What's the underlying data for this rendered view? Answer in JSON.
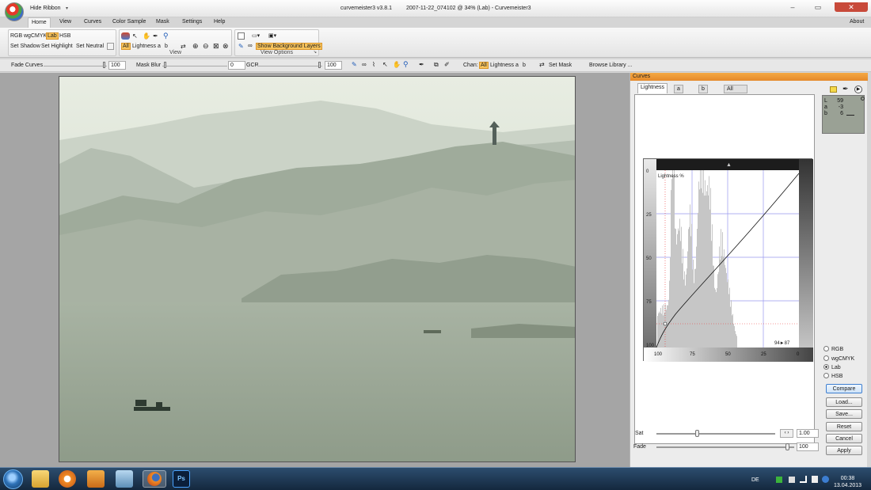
{
  "window": {
    "hide_ribbon": "Hide Ribbon",
    "app_title": "curvemeister3 v3.8.1",
    "doc_title": "2007-11-22_074102 @ 34% (Lab) - Curvemeister3"
  },
  "tabs": [
    "Home",
    "View",
    "Curves",
    "Color Sample",
    "Mask",
    "Settings",
    "Help"
  ],
  "about": "About",
  "ribbon": {
    "modes": [
      "RGB",
      "wgCMYK",
      "Lab",
      "HSB"
    ],
    "active_mode": "Lab",
    "set_shadow": "Set Shadow",
    "set_highlight": "Set Highlight",
    "set_neutral": "Set Neutral",
    "channels": [
      "All",
      "Lightness",
      "a",
      "b"
    ],
    "view_label": "View",
    "show_bg_layers": "Show Background Layers",
    "view_options_label": "View Options"
  },
  "toolbar2": {
    "fade_curves": "Fade Curves",
    "fade_value": "100",
    "mask_blur": "Mask Blur",
    "mask_value": "0",
    "gcr": "GCR",
    "gcr_value": "100",
    "chan_label": "Chan:",
    "chan_items": [
      "All",
      "Lightness",
      "a",
      "b"
    ],
    "set_mask": "Set Mask",
    "browse_library": "Browse Library ..."
  },
  "panel": {
    "header": "Curves",
    "tabs": [
      "Lightness",
      "a",
      "b",
      "All"
    ],
    "graph_label": "Lightness %",
    "y_ticks": [
      "0",
      "25",
      "50",
      "75",
      "100"
    ],
    "x_ticks": [
      "100",
      "75",
      "50",
      "25",
      "0"
    ],
    "readout": "94►87",
    "info": {
      "L": "59",
      "a": "-3",
      "b": "6"
    },
    "radios": [
      "RGB",
      "wgCMYK",
      "Lab",
      "HSB"
    ],
    "selected_radio": "Lab",
    "buttons": {
      "compare": "Compare",
      "load": "Load...",
      "save": "Save...",
      "reset": "Reset",
      "cancel": "Cancel",
      "apply": "Apply"
    },
    "sat_label": "Sat",
    "sat_value": "1.00",
    "fade_label": "Fade",
    "fade_value": "100"
  },
  "taskbar": {
    "lang": "DE",
    "time": "00:38",
    "date": "13.04.2013"
  },
  "colors": {
    "accent": "#f0a040",
    "selection": "#f7c35c",
    "grid": "#9999ee",
    "taskbar": "#1c3450"
  }
}
